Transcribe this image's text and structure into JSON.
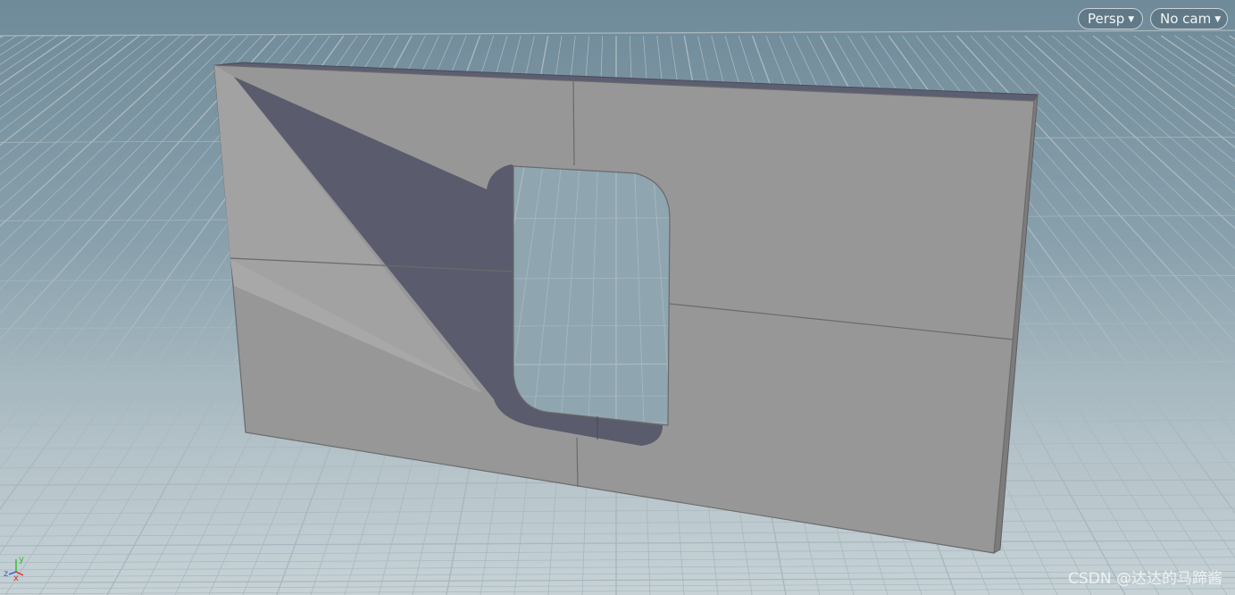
{
  "viewport": {
    "camera_mode_label": "Persp",
    "camera_label": "No cam"
  },
  "axes": {
    "x_label": "x",
    "y_label": "y",
    "z_label": "z"
  },
  "watermark": "CSDN @达达的马蹄酱",
  "colors": {
    "background_top": "#6f8a99",
    "background_bottom": "#c6d2d6",
    "grid_line": "#9fb0b7",
    "wall_face": "#9a9a9a",
    "wall_inner": "#5b5c6e",
    "axis_x": "#e03030",
    "axis_y": "#30c030",
    "axis_z": "#4060e0"
  }
}
